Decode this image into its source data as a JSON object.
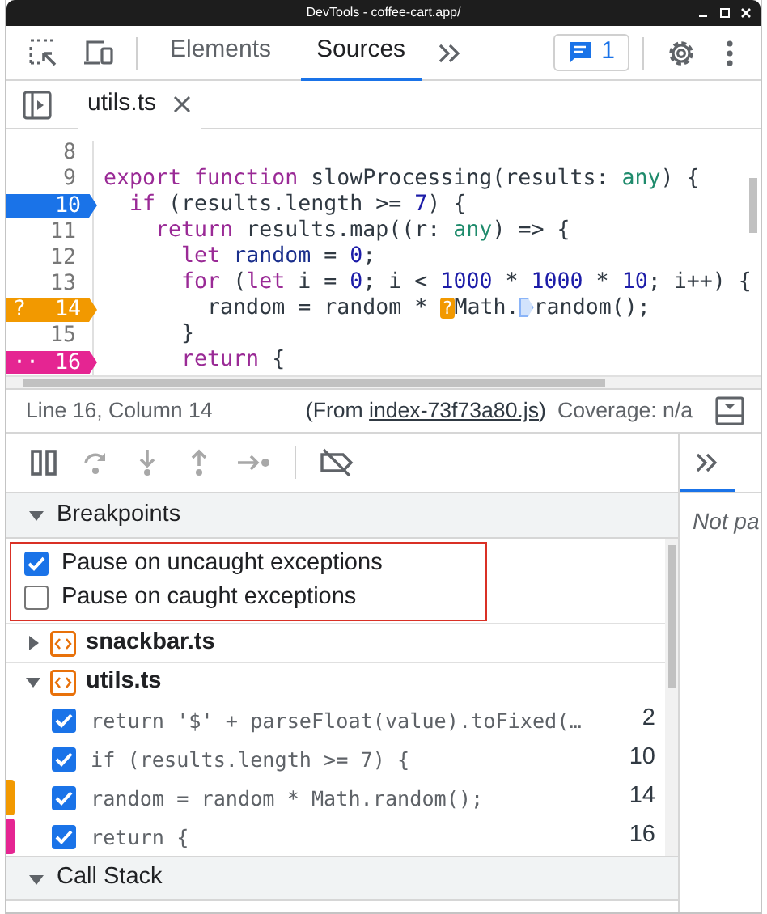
{
  "window": {
    "title": "DevTools - coffee-cart.app/"
  },
  "tabs": [
    {
      "label": "Elements",
      "selected": false
    },
    {
      "label": "Sources",
      "selected": true
    }
  ],
  "issues": {
    "count": "1"
  },
  "file_tabs": [
    {
      "label": "utils.ts",
      "selected": true
    }
  ],
  "editor": {
    "lines": [
      {
        "number": "8",
        "kind": "plain"
      },
      {
        "number": "9",
        "kind": "plain",
        "tokens": [
          {
            "kind": "keyword",
            "text": "export function"
          },
          {
            "kind": "plain",
            "text": " slowProcessing(results: "
          },
          {
            "kind": "type",
            "text": "any"
          },
          {
            "kind": "plain",
            "text": ") {"
          }
        ]
      },
      {
        "number": "10",
        "kind": "breakpoint",
        "tokens": [
          {
            "kind": "keyword",
            "text": "  if"
          },
          {
            "kind": "plain",
            "text": " (results.length >= "
          },
          {
            "kind": "number",
            "text": "7"
          },
          {
            "kind": "plain",
            "text": ") {"
          }
        ]
      },
      {
        "number": "11",
        "kind": "plain",
        "tokens": [
          {
            "kind": "keyword",
            "text": "    return"
          },
          {
            "kind": "plain",
            "text": " results.map((r: "
          },
          {
            "kind": "type",
            "text": "any"
          },
          {
            "kind": "plain",
            "text": ") => {"
          }
        ]
      },
      {
        "number": "12",
        "kind": "plain",
        "tokens": [
          {
            "kind": "keyword",
            "text": "      let"
          },
          {
            "kind": "def",
            "text": " random"
          },
          {
            "kind": "plain",
            "text": " = "
          },
          {
            "kind": "number",
            "text": "0"
          },
          {
            "kind": "plain",
            "text": ";"
          }
        ]
      },
      {
        "number": "13",
        "kind": "plain",
        "tokens": [
          {
            "kind": "keyword",
            "text": "      for"
          },
          {
            "kind": "plain",
            "text": " ("
          },
          {
            "kind": "keyword",
            "text": "let"
          },
          {
            "kind": "plain",
            "text": " i = "
          },
          {
            "kind": "number",
            "text": "0"
          },
          {
            "kind": "plain",
            "text": "; i < "
          },
          {
            "kind": "number",
            "text": "1000"
          },
          {
            "kind": "plain",
            "text": " * "
          },
          {
            "kind": "number",
            "text": "1000"
          },
          {
            "kind": "plain",
            "text": " * "
          },
          {
            "kind": "number",
            "text": "10"
          },
          {
            "kind": "plain",
            "text": "; i++) {"
          }
        ]
      },
      {
        "number": "14",
        "kind": "conditional-breakpoint",
        "marker_symbol": "?",
        "tokens": [
          {
            "kind": "plain",
            "text": "        random = random * "
          },
          {
            "kind": "conditional-marker",
            "text": "?"
          },
          {
            "kind": "plain",
            "text": "Math."
          },
          {
            "kind": "regular-marker"
          },
          {
            "kind": "plain",
            "text": "random();"
          }
        ]
      },
      {
        "number": "15",
        "kind": "plain",
        "tokens": [
          {
            "kind": "plain",
            "text": "      }"
          }
        ]
      },
      {
        "number": "16",
        "kind": "logpoint",
        "marker_symbol": "··",
        "tokens": [
          {
            "kind": "keyword",
            "text": "      return"
          },
          {
            "kind": "plain",
            "text": " {"
          }
        ]
      }
    ]
  },
  "status": {
    "position": "Line 16, Column 14",
    "from_prefix": "(From ",
    "from_link": "index-73f73a80.js",
    "from_suffix": ")",
    "coverage": "Coverage: n/a"
  },
  "breakpoints": {
    "title": "Breakpoints",
    "expanded": true,
    "exceptions": [
      {
        "label": "Pause on uncaught exceptions",
        "checked": true
      },
      {
        "label": "Pause on caught exceptions",
        "checked": false
      }
    ],
    "highlighted": true,
    "files": [
      {
        "name": "snackbar.ts",
        "expanded": false
      },
      {
        "name": "utils.ts",
        "expanded": true,
        "items": [
          {
            "code": "return '$' + parseFloat(value).toFixed(…",
            "line": "2",
            "checked": true,
            "kind": "regular"
          },
          {
            "code": "if (results.length >= 7) {",
            "line": "10",
            "checked": true,
            "kind": "regular"
          },
          {
            "code": "random = random * Math.random();",
            "line": "14",
            "checked": true,
            "kind": "conditional"
          },
          {
            "code": "return {",
            "line": "16",
            "checked": true,
            "kind": "logpoint"
          }
        ]
      }
    ]
  },
  "call_stack": {
    "title": "Call Stack",
    "expanded": true
  },
  "side_panel": {
    "text": "Not pa"
  }
}
